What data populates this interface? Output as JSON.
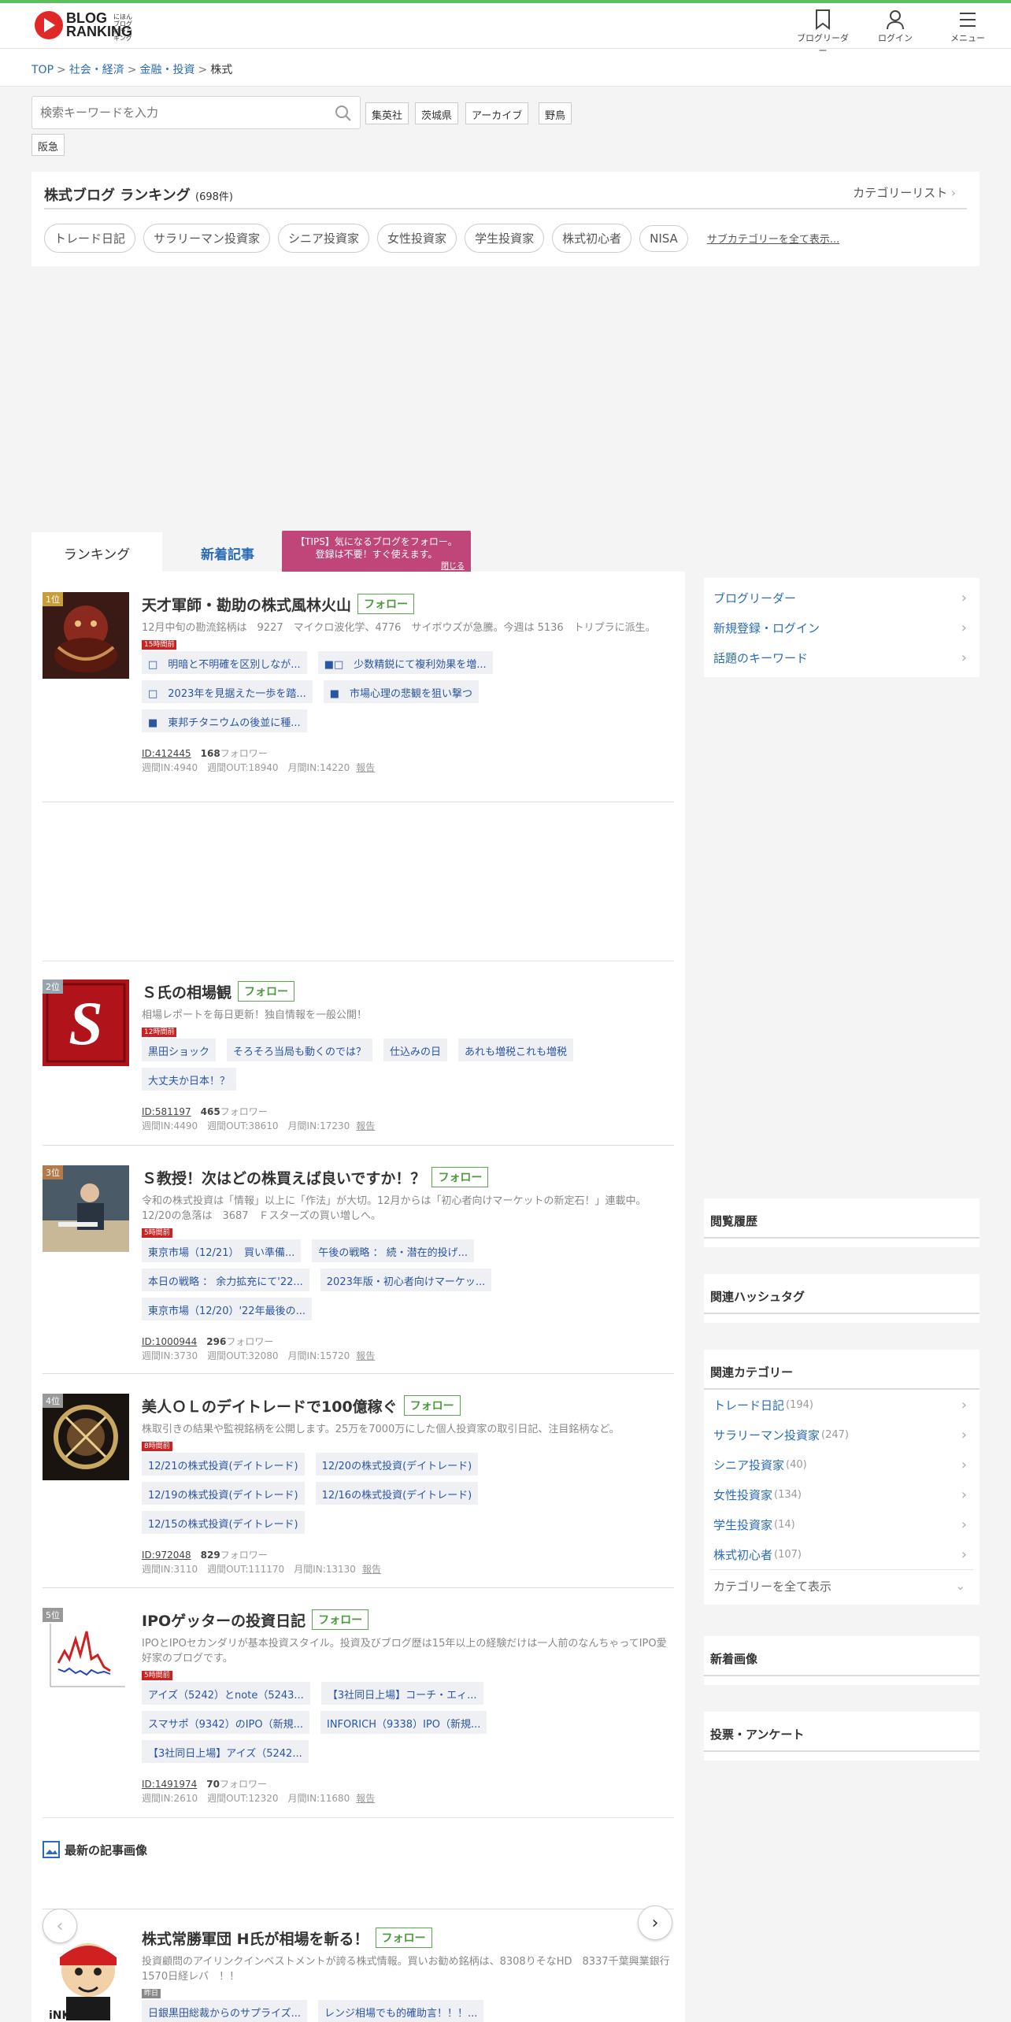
{
  "header": {
    "logo_main_1": "BLOG",
    "logo_main_2": "RANKING",
    "logo_sub": "にほんブログ村ランキング",
    "nav": [
      {
        "label": "ブログリーダー"
      },
      {
        "label": "ログイン"
      },
      {
        "label": "メニュー"
      }
    ]
  },
  "breadcrumb": [
    "TOP",
    "社会・経済",
    "金融・投資",
    "株式"
  ],
  "search": {
    "placeholder": "検索キーワードを入力",
    "keywords": [
      "集英社",
      "茨城県",
      "アーカイブ",
      "野鳥",
      "阪急"
    ]
  },
  "category": {
    "title": "株式ブログ ランキング",
    "count": "(698件)",
    "list_link": "カテゴリーリスト",
    "subcats": [
      "トレード日記",
      "サラリーマン投資家",
      "シニア投資家",
      "女性投資家",
      "学生投資家",
      "株式初心者",
      "NISA"
    ],
    "more": "サブカテゴリーを全て表示..."
  },
  "tabs": {
    "ranking": "ランキング",
    "new_posts": "新着記事",
    "tips_line1": "【TIPS】気になるブログをフォロー。",
    "tips_line2": "登録は不要！すぐ使えます。",
    "tips_close": "閉じる"
  },
  "follow_label": "フォロー",
  "entries": [
    {
      "rank": "1位",
      "title": "天才軍師・勘助の株式風林火山",
      "desc": "12月中旬の勘流銘柄は　9227　マイクロ波化学、4776　サイボウズが急騰。今週は 5136　トリプラに派生。",
      "new": "15時間前",
      "posts": [
        "□　明暗と不明確を区別しなが...",
        "■□　少数精鋭にて複利効果を増...",
        "□　2023年を見据えた一歩を踏...",
        "■　市場心理の悲観を狙い撃つ",
        "■　東邦チタニウムの後並に種..."
      ],
      "id": "ID:412445",
      "followers": "168",
      "followers_label": "フォロワー",
      "weekly": "週間IN:4940　週間OUT:18940　月間IN:14220",
      "report": "報告"
    },
    {
      "rank": "2位",
      "title": "Ｓ氏の相場観",
      "desc": "相場レポートを毎日更新！独自情報を一般公開！",
      "new": "12時間前",
      "posts": [
        "黒田ショック",
        "そろそろ当局も動くのでは？",
        "仕込みの日",
        "あれも増税これも増税",
        "大丈夫か日本！？"
      ],
      "id": "ID:581197",
      "followers": "465",
      "followers_label": "フォロワー",
      "weekly": "週間IN:4490　週間OUT:38610　月間IN:17230",
      "report": "報告"
    },
    {
      "rank": "3位",
      "title": "Ｓ教授！次はどの株買えば良いですか！？",
      "desc": "令和の株式投資は「情報」以上に「作法」が大切。12月からは「初心者向けマーケットの新定石！」連載中。12/20の急落は　3687　Ｆスターズの買い増しへ。",
      "new": "5時間前",
      "posts": [
        "東京市場（12/21）　買い準備...",
        "午後の戦略 ： 続・潜在的投げ...",
        "本日の戦略 ： 余力拡充にて'22...",
        "2023年版・初心者向けマーケッ...",
        "東京市場（12/20）'22年最後の..."
      ],
      "id": "ID:1000944",
      "followers": "296",
      "followers_label": "フォロワー",
      "weekly": "週間IN:3730　週間OUT:32080　月間IN:15720",
      "report": "報告"
    },
    {
      "rank": "4位",
      "title": "美人ＯＬのデイトレードで100億稼ぐ",
      "desc": "株取引きの結果や監視銘柄を公開します。25万を7000万にした個人投資家の取引日記、注目銘柄など。",
      "new": "8時間前",
      "posts": [
        "12/21の株式投資(デイトレード)",
        "12/20の株式投資(デイトレード)",
        "12/19の株式投資(デイトレード)",
        "12/16の株式投資(デイトレード)",
        "12/15の株式投資(デイトレード)"
      ],
      "id": "ID:972048",
      "followers": "829",
      "followers_label": "フォロワー",
      "weekly": "週間IN:3110　週間OUT:111170　月間IN:13130",
      "report": "報告"
    },
    {
      "rank": "5位",
      "title": "IPOゲッターの投資日記",
      "desc": "IPOとIPOセカンダリが基本投資スタイル。投資及びブログ歴は15年以上の経験だけは一人前のなんちゃってIPO愛好家のブログです。",
      "new": "5時間前",
      "posts": [
        "アイズ（5242）とnote（5243...",
        "【3社同日上場】コーチ・エィ...",
        "スマサポ（9342）のIPO（新規...",
        "INFORICH（9338）IPO（新規...",
        "【3社同日上場】アイズ（5242..."
      ],
      "id": "ID:1491974",
      "followers": "70",
      "followers_label": "フォロワー",
      "weekly": "週間IN:2610　週間OUT:12320　月間IN:11680",
      "report": "報告"
    },
    {
      "rank": "",
      "title": "株式常勝軍団 H氏が相場を斬る！",
      "desc": "投資顧問のアイリンクインベストメントが誇る株式情報。買いお勧め銘柄は、8308りそなHD　8337千葉興業銀行　1570日経レバ　！！",
      "new": "昨日",
      "posts": [
        "日銀黒田総裁からのサプライズ...",
        "レンジ相場でも的確助言！！！..."
      ],
      "id": "",
      "followers": "",
      "followers_label": "",
      "weekly": "",
      "report": ""
    }
  ],
  "latest_images_title": "最新の記事画像",
  "sidebar": {
    "links": [
      "ブログリーダー",
      "新規登録・ログイン",
      "話題のキーワード"
    ],
    "history": "閲覧履歴",
    "hashtags": "関連ハッシュタグ",
    "related": "関連カテゴリー",
    "related_items": [
      {
        "name": "トレード日記",
        "count": "(194)"
      },
      {
        "name": "サラリーマン投資家",
        "count": "(247)"
      },
      {
        "name": "シニア投資家",
        "count": "(40)"
      },
      {
        "name": "女性投資家",
        "count": "(134)"
      },
      {
        "name": "学生投資家",
        "count": "(14)"
      },
      {
        "name": "株式初心者",
        "count": "(107)"
      }
    ],
    "all_categories": "カテゴリーを全て表示",
    "new_images": "新着画像",
    "votes": "投票・アンケート"
  },
  "colors": {
    "accent_green": "#5bbf5b",
    "link_blue": "#2a6bb8",
    "tips_pink": "#c0467a",
    "new_red": "#cc2222"
  }
}
